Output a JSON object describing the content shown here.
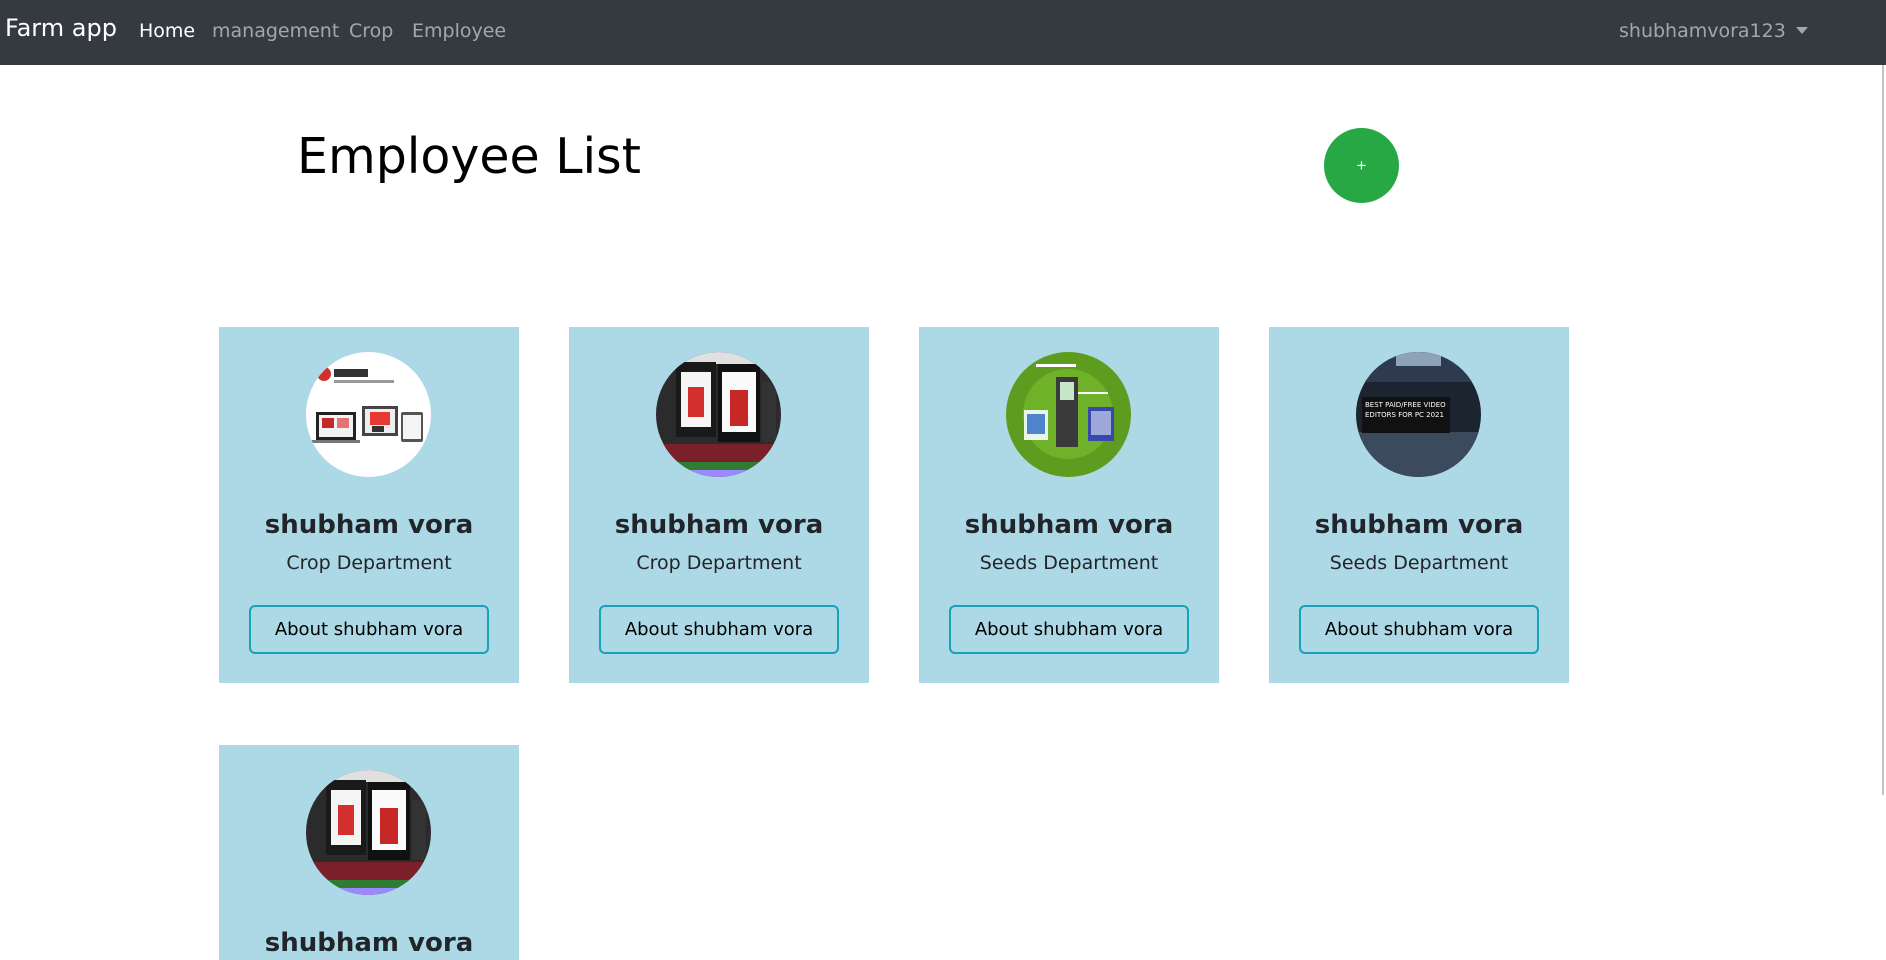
{
  "navbar": {
    "brand": "Farm app",
    "links": [
      "Home",
      "management",
      "Crop",
      "Employee"
    ],
    "user": "shubhamvora123"
  },
  "page": {
    "title": "Employee List",
    "add_label": "+"
  },
  "employees": [
    {
      "name": "shubham vora",
      "department": "Crop Department",
      "button": "About shubham vora",
      "avatar": "adblock-thumbnail"
    },
    {
      "name": "shubham vora",
      "department": "Crop Department",
      "button": "About shubham vora",
      "avatar": "video-editor-thumbnail"
    },
    {
      "name": "shubham vora",
      "department": "Seeds Department",
      "button": "About shubham vora",
      "avatar": "green-devices-thumbnail"
    },
    {
      "name": "shubham vora",
      "department": "Seeds Department",
      "button": "About shubham vora",
      "avatar": "video-editors-pc-thumbnail",
      "avatar_text": "BEST PAID/FREE VIDEO EDITORS FOR PC 2021"
    },
    {
      "name": "shubham vora",
      "avatar": "video-editor-thumbnail"
    }
  ],
  "colors": {
    "navbar": "#343a40",
    "card": "#add8e6",
    "add_button": "#28a745",
    "outline_button": "#17a2b8"
  }
}
